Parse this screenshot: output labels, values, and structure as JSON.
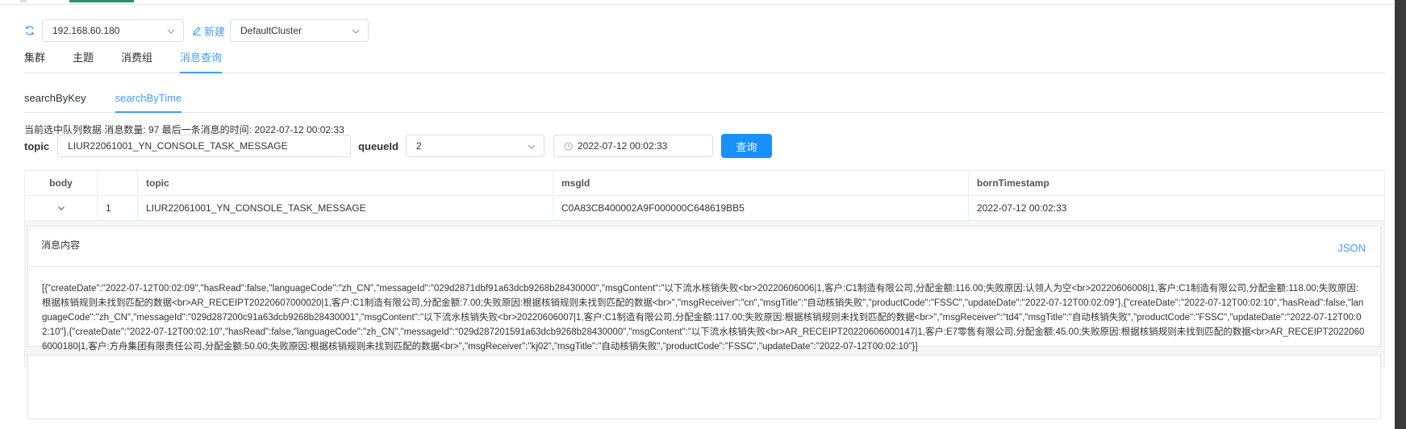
{
  "toolbar": {
    "server_select": "192.168.60.180",
    "new_label": "新建",
    "cluster_select": "DefaultCluster"
  },
  "nav": {
    "items": [
      {
        "label": "集群",
        "active": false
      },
      {
        "label": "主题",
        "active": false
      },
      {
        "label": "消费组",
        "active": false
      },
      {
        "label": "消息查询",
        "active": true
      }
    ]
  },
  "subtabs": {
    "items": [
      {
        "label": "searchByKey",
        "active": false
      },
      {
        "label": "searchByTime",
        "active": true
      }
    ]
  },
  "status": {
    "text": "当前选中队列数据 消息数量: 97 最后一条消息的时间: 2022-07-12 00:02:33"
  },
  "form": {
    "topic_label": "topic",
    "topic_value": "LIUR22061001_YN_CONSOLE_TASK_MESSAGE",
    "queue_label": "queueId",
    "queue_value": "2",
    "time_value": "2022-07-12 00:02:33",
    "query_button": "查询"
  },
  "table": {
    "headers": [
      "body",
      "",
      "topic",
      "msgId",
      "bornTimestamp"
    ],
    "rows": [
      {
        "index": "1",
        "topic": "LIUR22061001_YN_CONSOLE_TASK_MESSAGE",
        "msgId": "C0A83CB400002A9F000000C648619BB5",
        "bornTimestamp": "2022-07-12 00:02:33"
      }
    ]
  },
  "detail": {
    "title": "消息内容",
    "json_link": "JSON",
    "content": "[{\"createDate\":\"2022-07-12T00:02:09\",\"hasRead\":false,\"languageCode\":\"zh_CN\",\"messageId\":\"029d2871dbf91a63dcb9268b28430000\",\"msgContent\":\"以下流水核销失败<br>20220606006|1,客户:C1制造有限公司,分配金额:116.00;失败原因:认领人为空<br>20220606008|1,客户:C1制造有限公司,分配金额:118.00;失败原因:根据核销规则未找到匹配的数据<br>AR_RECEIPT20220607000020|1,客户:C1制造有限公司,分配金额:7.00;失败原因:根据核销规则未找到匹配的数据<br>\",\"msgReceiver\":\"cn\",\"msgTitle\":\"自动核销失败\",\"productCode\":\"FSSC\",\"updateDate\":\"2022-07-12T00:02:09\"},{\"createDate\":\"2022-07-12T00:02:10\",\"hasRead\":false,\"languageCode\":\"zh_CN\",\"messageId\":\"029d287200c91a63dcb9268b28430001\",\"msgContent\":\"以下流水核销失败<br>20220606007|1,客户:C1制造有限公司,分配金额:117.00;失败原因:根据核销规则未找到匹配的数据<br>\",\"msgReceiver\":\"td4\",\"msgTitle\":\"自动核销失败\",\"productCode\":\"FSSC\",\"updateDate\":\"2022-07-12T00:02:10\"},{\"createDate\":\"2022-07-12T00:02:10\",\"hasRead\":false,\"languageCode\":\"zh_CN\",\"messageId\":\"029d287201591a63dcb9268b28430000\",\"msgContent\":\"以下流水核销失败<br>AR_RECEIPT20220606000147|1,客户:E7零售有限公司,分配金额:45.00;失败原因:根据核销规则未找到匹配的数据<br>AR_RECEIPT20220606000180|1,客户:方舟集团有限责任公司,分配金额:50.00;失败原因:根据核销规则未找到匹配的数据<br>\",\"msgReceiver\":\"kj02\",\"msgTitle\":\"自动核销失败\",\"productCode\":\"FSSC\",\"updateDate\":\"2022-07-12T00:02:10\"}]"
  },
  "colors": {
    "accent": "#409eff",
    "primary_button": "#1890ff"
  }
}
